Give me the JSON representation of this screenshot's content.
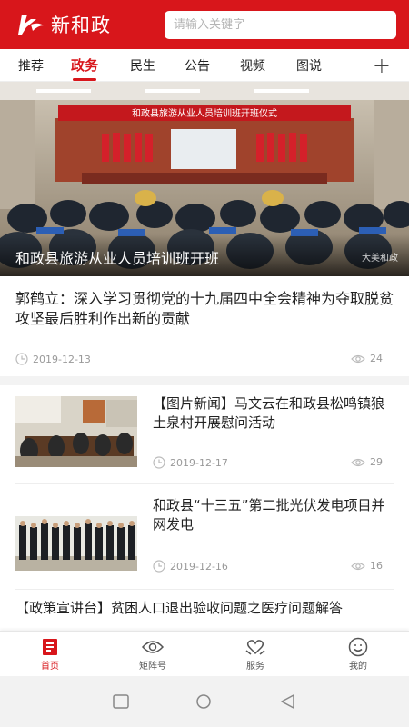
{
  "header": {
    "app_name": "新和政",
    "search_placeholder": "请输入关键字"
  },
  "tabs": [
    {
      "label": "推荐",
      "active": false
    },
    {
      "label": "政务",
      "active": true
    },
    {
      "label": "民生",
      "active": false
    },
    {
      "label": "公告",
      "active": false
    },
    {
      "label": "视频",
      "active": false
    },
    {
      "label": "图说",
      "active": false
    }
  ],
  "tabs_add_icon": "plus-icon",
  "banner": {
    "title": "和政县旅游从业人员培训班开班",
    "stage_banner": "和政县旅游从业人员培训班开班仪式",
    "watermark": "大美和政"
  },
  "articles": [
    {
      "title": "郭鹤立：深入学习贯彻党的十九届四中全会精神为夺取脱贫攻坚最后胜利作出新的贡献",
      "date": "2019-12-13",
      "views": "24"
    },
    {
      "title": "【图片新闻】马文云在和政县松鸣镇狼土泉村开展慰问活动",
      "date": "2019-12-17",
      "views": "29"
    },
    {
      "title": "和政县“十三五”第二批光伏发电项目并网发电",
      "date": "2019-12-16",
      "views": "16"
    },
    {
      "title": "【政策宣讲台】贫困人口退出验收问题之医疗问题解答"
    }
  ],
  "bottom_nav": [
    {
      "label": "首页",
      "icon": "home-icon",
      "active": true
    },
    {
      "label": "矩阵号",
      "icon": "eye-icon",
      "active": false
    },
    {
      "label": "服务",
      "icon": "heart-hands-icon",
      "active": false
    },
    {
      "label": "我的",
      "icon": "smiley-icon",
      "active": false
    }
  ],
  "colors": {
    "brand_red": "#d8161b",
    "meta_gray": "#999999"
  }
}
